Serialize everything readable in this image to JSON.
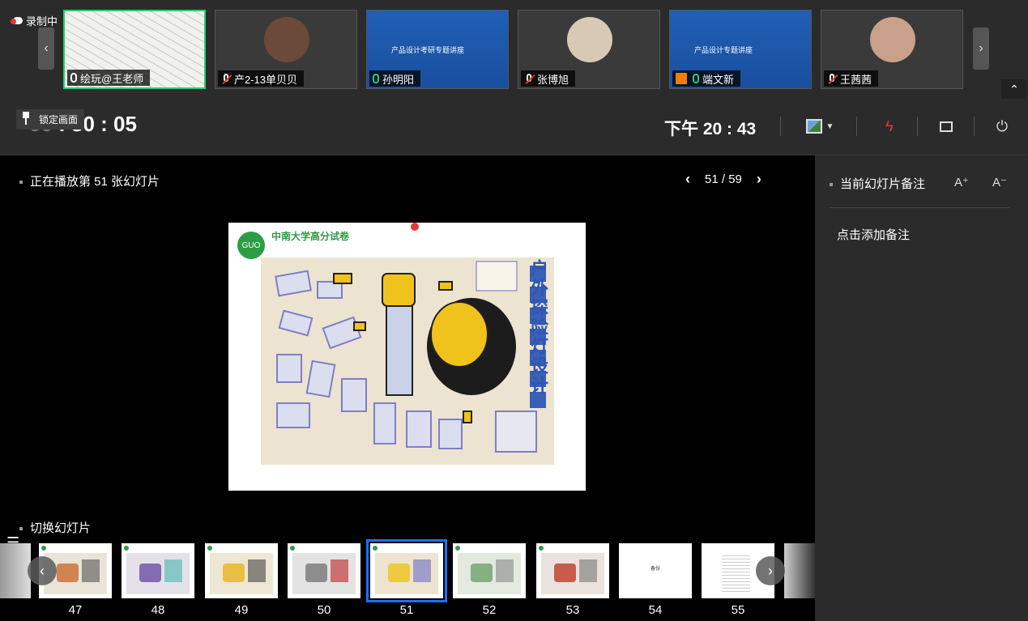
{
  "recording": {
    "label": "录制中"
  },
  "participants": [
    {
      "name": "绘玩@王老师",
      "mic": "on",
      "active": true,
      "kind": "sketch"
    },
    {
      "name": "产2-13单贝贝",
      "mic": "off",
      "active": false,
      "kind": "avatar",
      "avatar_color": "#6b4a3a"
    },
    {
      "name": "孙明阳",
      "mic": "on",
      "active": false,
      "kind": "slide",
      "slide_title": "产品设计考研专题讲座"
    },
    {
      "name": "张博旭",
      "mic": "off",
      "active": false,
      "kind": "avatar",
      "avatar_color": "#d8c9b5"
    },
    {
      "name": "端文新",
      "mic": "on",
      "active": false,
      "kind": "slide",
      "slide_title": "产品设计专题讲座",
      "badge": true
    },
    {
      "name": "王茜茜",
      "mic": "off",
      "active": false,
      "kind": "avatar",
      "avatar_color": "#c9a08a"
    }
  ],
  "control_bar": {
    "lock_label": "锁定画面",
    "timer_prefix": "00",
    "timer_rest": " : 30 : 05",
    "clock": "下午 20 : 43"
  },
  "main": {
    "now_playing": "正在播放第 51 张幻灯片",
    "current_page": "51",
    "page_separator": "/",
    "total_pages": "59"
  },
  "slide": {
    "logo_text": "中南大学高分试卷",
    "logo_mark": "GUO",
    "sketch_title": "户外探险灯设计"
  },
  "thumbnails": {
    "label": "切换幻灯片",
    "items": [
      {
        "number": "47",
        "style": "sketch"
      },
      {
        "number": "48",
        "style": "sketch"
      },
      {
        "number": "49",
        "style": "sketch"
      },
      {
        "number": "50",
        "style": "sketch"
      },
      {
        "number": "51",
        "style": "sketch",
        "selected": true
      },
      {
        "number": "52",
        "style": "sketch"
      },
      {
        "number": "53",
        "style": "sketch"
      },
      {
        "number": "54",
        "style": "blank",
        "text": "备份"
      },
      {
        "number": "55",
        "style": "list"
      }
    ]
  },
  "notes": {
    "title": "当前幻灯片备注",
    "font_up": "A⁺",
    "font_down": "A⁻",
    "add_note": "点击添加备注"
  },
  "colors": {
    "accent": "#1e6fff",
    "active_border": "#2ecc71",
    "end_red": "#e53935"
  }
}
